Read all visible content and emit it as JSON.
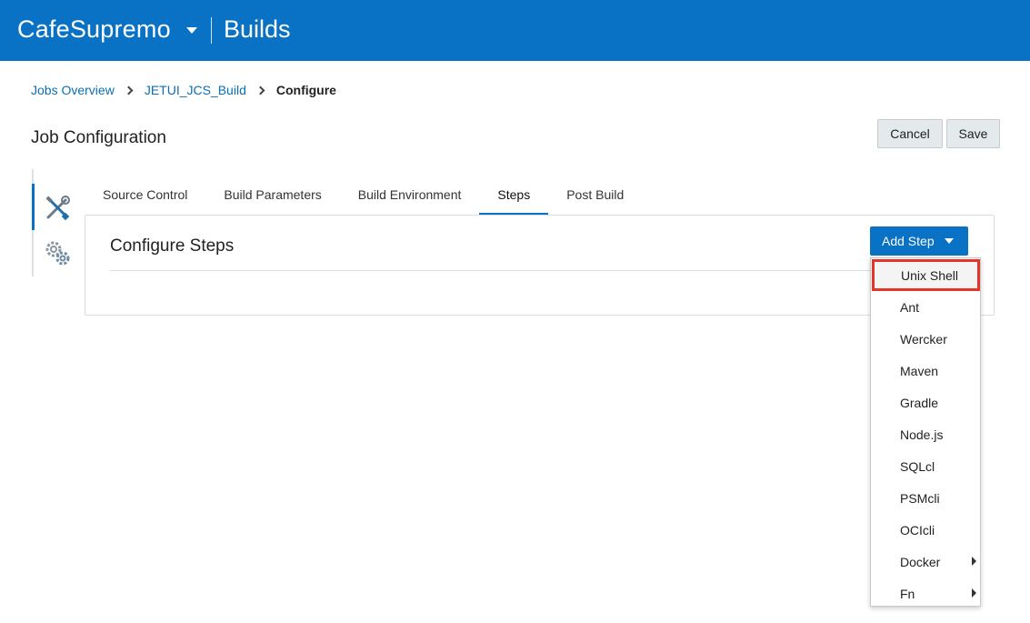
{
  "header": {
    "project": "CafeSupremo",
    "section": "Builds"
  },
  "breadcrumb": {
    "items": [
      "Jobs Overview",
      "JETUI_JCS_Build"
    ],
    "current": "Configure"
  },
  "page": {
    "title": "Job Configuration",
    "cancel_label": "Cancel",
    "save_label": "Save"
  },
  "side_nav": {
    "items": [
      {
        "icon": "tools-icon",
        "active": true
      },
      {
        "icon": "gears-icon",
        "active": false
      }
    ]
  },
  "tabs": [
    {
      "label": "Source Control",
      "active": false
    },
    {
      "label": "Build Parameters",
      "active": false
    },
    {
      "label": "Build Environment",
      "active": false
    },
    {
      "label": "Steps",
      "active": true
    },
    {
      "label": "Post Build",
      "active": false
    }
  ],
  "panel": {
    "title": "Configure Steps",
    "add_step_label": "Add Step"
  },
  "menu": {
    "items": [
      {
        "label": "Unix Shell",
        "highlighted": true,
        "submenu": false
      },
      {
        "label": "Ant",
        "submenu": false
      },
      {
        "label": "Wercker",
        "submenu": false
      },
      {
        "label": "Maven",
        "submenu": false
      },
      {
        "label": "Gradle",
        "submenu": false
      },
      {
        "label": "Node.js",
        "submenu": false
      },
      {
        "label": "SQLcl",
        "submenu": false
      },
      {
        "label": "PSMcli",
        "submenu": false
      },
      {
        "label": "OCIcli",
        "submenu": false
      },
      {
        "label": "Docker",
        "submenu": true
      },
      {
        "label": "Fn",
        "submenu": true
      }
    ]
  },
  "colors": {
    "brand": "#0a72c4",
    "highlight_outline": "#e5352b"
  }
}
